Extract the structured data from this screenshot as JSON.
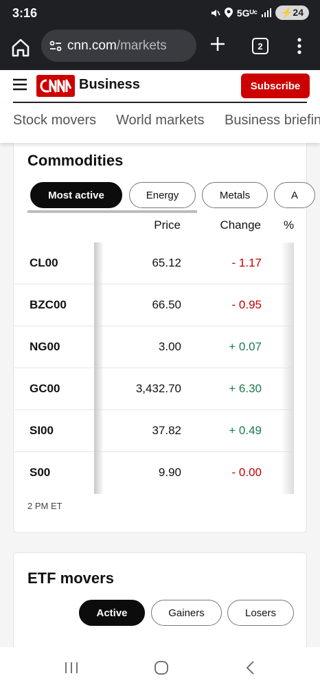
{
  "status_bar": {
    "time": "3:16",
    "network": "5Gᵁᶜ",
    "battery": "24"
  },
  "browser": {
    "url_host": "cnn.com",
    "url_path": "/markets",
    "tab_count": "2"
  },
  "site_header": {
    "logo_text": "CNN",
    "section": "Business",
    "subscribe_label": "Subscribe",
    "brand_color": "#cc0000"
  },
  "sub_nav": {
    "items": [
      "Stock movers",
      "World markets",
      "Business briefing"
    ]
  },
  "commodities": {
    "title": "Commodities",
    "tabs": [
      {
        "label": "Most active",
        "active": true
      },
      {
        "label": "Energy",
        "active": false
      },
      {
        "label": "Metals",
        "active": false
      },
      {
        "label": "A",
        "active": false
      }
    ],
    "columns": {
      "price": "Price",
      "change": "Change",
      "percent": "%"
    },
    "rows": [
      {
        "symbol": "CL00",
        "price": "65.12",
        "change": "- 1.17",
        "direction": "down"
      },
      {
        "symbol": "BZC00",
        "price": "66.50",
        "change": "- 0.95",
        "direction": "down"
      },
      {
        "symbol": "NG00",
        "price": "3.00",
        "change": "+ 0.07",
        "direction": "up"
      },
      {
        "symbol": "GC00",
        "price": "3,432.70",
        "change": "+ 6.30",
        "direction": "up"
      },
      {
        "symbol": "SI00",
        "price": "37.82",
        "change": "+ 0.49",
        "direction": "up"
      },
      {
        "symbol": "S00",
        "price": "9.90",
        "change": "- 0.00",
        "direction": "down"
      }
    ],
    "timestamp": "2 PM ET"
  },
  "etf_movers": {
    "title": "ETF movers",
    "tabs": [
      {
        "label": "Active",
        "active": true
      },
      {
        "label": "Gainers",
        "active": false
      },
      {
        "label": "Losers",
        "active": false
      }
    ]
  },
  "colors": {
    "negative": "#c00000",
    "positive": "#1d7a4d"
  },
  "icons": {
    "status": [
      "mute-icon",
      "location-icon",
      "signal-icon",
      "battery-icon"
    ],
    "browser": [
      "home-icon",
      "site-settings-icon",
      "new-tab-plus-icon",
      "tab-switcher-icon",
      "more-vert-icon"
    ],
    "nav": [
      "recents-icon",
      "home-circle-icon",
      "back-icon"
    ]
  }
}
